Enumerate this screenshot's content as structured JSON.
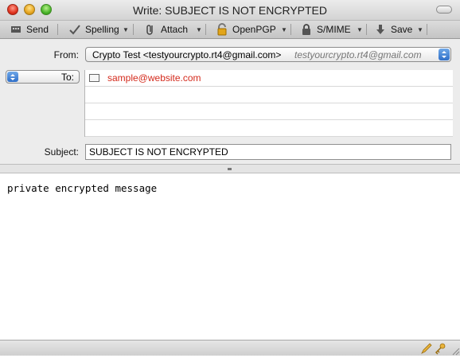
{
  "window": {
    "title": "Write: SUBJECT IS NOT ENCRYPTED"
  },
  "toolbar": {
    "send": "Send",
    "spelling": "Spelling",
    "attach": "Attach",
    "openpgp": "OpenPGP",
    "smime": "S/MIME",
    "save": "Save"
  },
  "header": {
    "from_label": "From:",
    "from_identity": "Crypto Test <testyourcrypto.rt4@gmail.com>",
    "from_account": "testyourcrypto.rt4@gmail.com",
    "to_label": "To:",
    "recipients": [
      "sample@website.com"
    ],
    "subject_label": "Subject:",
    "subject": "SUBJECT IS NOT ENCRYPTED"
  },
  "body": {
    "text": "private encrypted message"
  },
  "colors": {
    "recipient": "#d42a1c",
    "accent": "#2f6fc8"
  },
  "icons": [
    "send-icon",
    "spelling-icon",
    "attach-icon",
    "openpgp-icon",
    "smime-icon",
    "save-icon",
    "pencil-icon",
    "key-icon"
  ]
}
